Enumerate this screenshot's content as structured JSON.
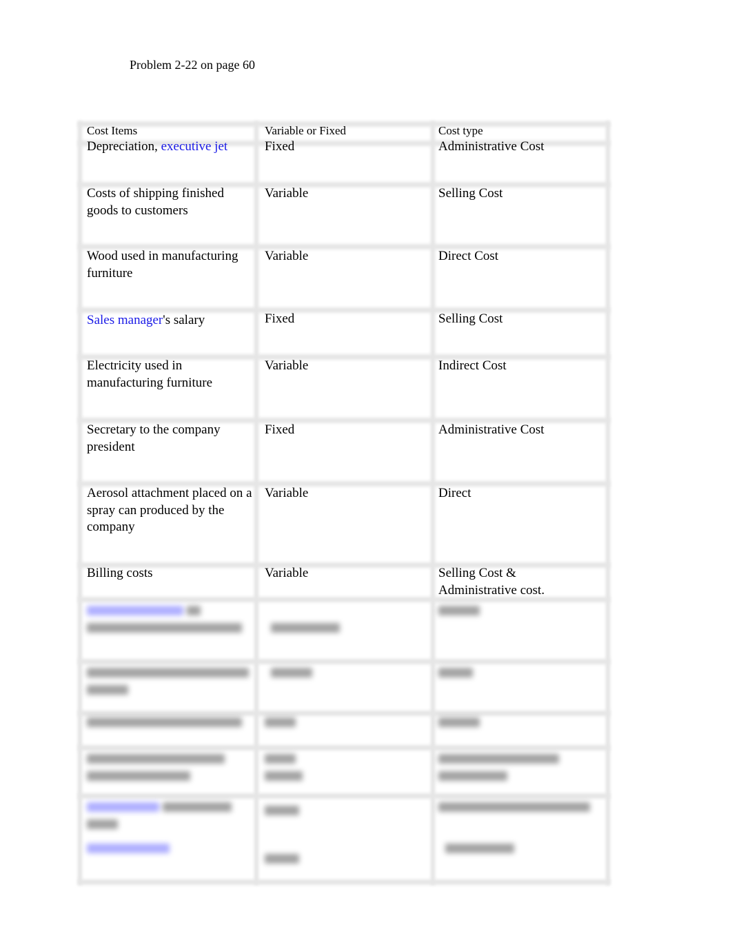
{
  "document": {
    "title": "Problem 2-22 on page 60"
  },
  "table": {
    "headers": [
      "Cost Items",
      "Variable or Fixed",
      "Cost type"
    ],
    "rows": [
      {
        "item_prefix": "Depreciation, ",
        "item_link": "executive jet",
        "item_suffix": "",
        "behavior": "Fixed",
        "type": "Administrative Cost"
      },
      {
        "item_prefix": "Costs of shipping finished goods to customers",
        "item_link": "",
        "item_suffix": "",
        "behavior": "Variable",
        "type": "Selling Cost"
      },
      {
        "item_prefix": "Wood used in manufacturing furniture",
        "item_link": "",
        "item_suffix": "",
        "behavior": "Variable",
        "type": "Direct Cost"
      },
      {
        "item_prefix": "",
        "item_link": "Sales manager",
        "item_suffix": "'s salary",
        "behavior": "Fixed",
        "type": "Selling Cost"
      },
      {
        "item_prefix": "Electricity used in manufacturing furniture",
        "item_link": "",
        "item_suffix": "",
        "behavior": "Variable",
        "type": "Indirect Cost"
      },
      {
        "item_prefix": "Secretary to the company president",
        "item_link": "",
        "item_suffix": "",
        "behavior": "Fixed",
        "type": "Administrative Cost"
      },
      {
        "item_prefix": "Aerosol attachment placed on a spray can produced by the company",
        "item_link": "",
        "item_suffix": "",
        "behavior": "Variable",
        "type": "Direct"
      },
      {
        "item_prefix": "Billing costs",
        "item_link": "",
        "item_suffix": "",
        "behavior": "Variable",
        "type": "Selling Cost & Administrative cost."
      }
    ],
    "obscured_rows_note": "Remaining rows blurred (unreadable)"
  },
  "colors": {
    "link": "#1a1ae6",
    "grid": "#e3e3e3"
  }
}
